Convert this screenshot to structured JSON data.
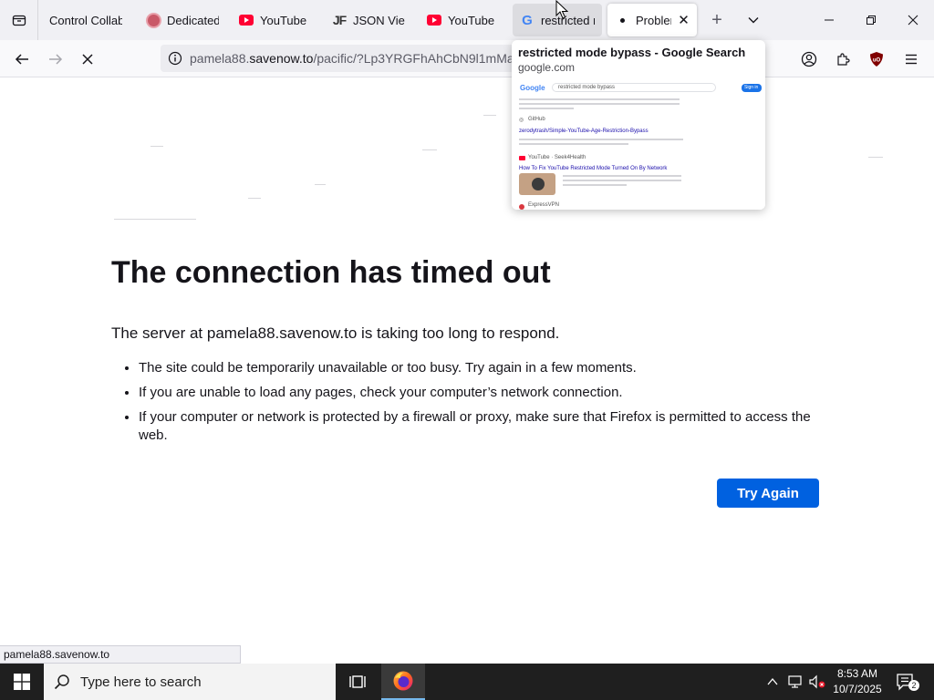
{
  "tabs": [
    {
      "label": "Control Collabo",
      "favicon": "circle-icon",
      "state": "normal"
    },
    {
      "label": "Dedicated",
      "favicon": "cog-icon",
      "state": "normal"
    },
    {
      "label": "YouTube",
      "favicon": "youtube-icon",
      "state": "normal"
    },
    {
      "label": "JSON Viewer",
      "favicon": "jf-icon",
      "state": "normal"
    },
    {
      "label": "YouTube",
      "favicon": "youtube-icon",
      "state": "normal"
    },
    {
      "label": "restricted m",
      "favicon": "google-icon",
      "state": "hover"
    },
    {
      "label": "Problem",
      "favicon": "loading-dot-icon",
      "state": "active"
    }
  ],
  "urlbar": {
    "prefix": "pamela88.",
    "host": "savenow.to",
    "path": "/pacific/?Lp3YRGFhAhCbN9l1mMaw"
  },
  "tab_preview": {
    "title": "restricted mode bypass - Google Search",
    "domain": "google.com",
    "thumb": {
      "logo": "Google",
      "query": "restricted mode bypass",
      "signin": "Sign in",
      "result1_source": "GitHub",
      "result1_title": "zerodytrash/Simple-YouTube-Age-Restriction-Bypass",
      "result2_source": "YouTube · Seek4Health",
      "result2_title": "How To Fix YouTube Restricted Mode Turned On By Network",
      "result3_source": "ExpressVPN"
    }
  },
  "error_page": {
    "title": "The connection has timed out",
    "description": "The server at pamela88.savenow.to is taking too long to respond.",
    "bullets": [
      "The site could be temporarily unavailable or too busy. Try again in a few moments.",
      "If you are unable to load any pages, check your computer’s network connection.",
      "If your computer or network is protected by a firewall or proxy, make sure that Firefox is permitted to access the web."
    ],
    "button_label": "Try Again"
  },
  "status_bar": {
    "text": "pamela88.savenow.to"
  },
  "taskbar": {
    "search_placeholder": "Type here to search",
    "time": "8:53 AM",
    "date": "10/7/2025",
    "notification_count": "2"
  },
  "colors": {
    "accent": "#0061e0",
    "youtube_red": "#ff0033",
    "taskbar": "#1f1f1f"
  }
}
